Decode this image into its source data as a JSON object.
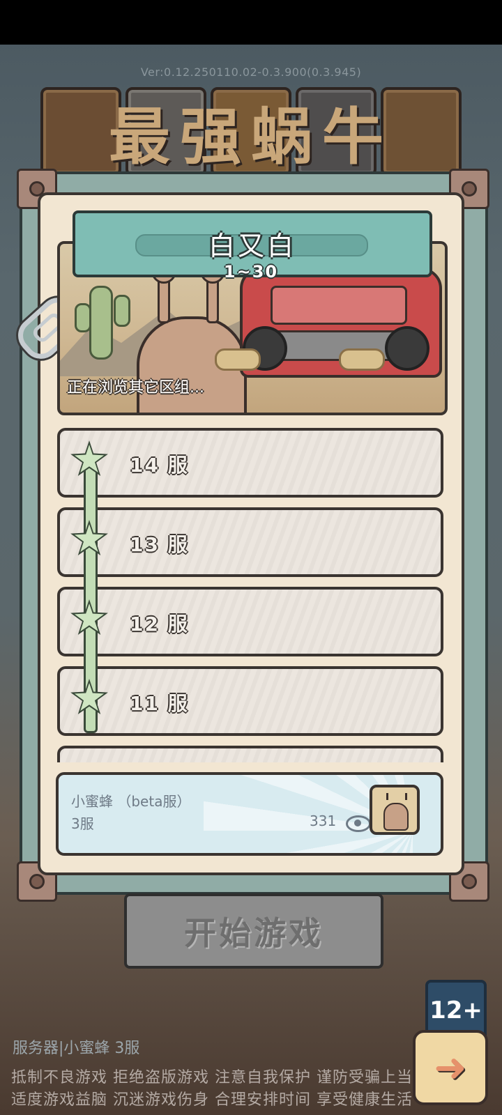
{
  "version": "Ver:0.12.250110.02-0.3.900(0.3.945)",
  "game_title": "最强蜗牛",
  "region": {
    "title": "白又白",
    "range": "1~30",
    "browsing_text": "正在浏览其它区组..."
  },
  "servers": [
    {
      "label": "14 服"
    },
    {
      "label": "13 服"
    },
    {
      "label": "12 服"
    },
    {
      "label": "11 服"
    }
  ],
  "current_server": {
    "name": "小蜜蜂 （beta服）",
    "number": "3服",
    "count": "331"
  },
  "start_button": "开始游戏",
  "age_rating": "12+",
  "server_status": "服务器|小蜜蜂 3服",
  "notice_line1": "抵制不良游戏 拒绝盗版游戏 注意自我保护 谨防受骗上当",
  "notice_line2": "适度游戏益脑 沉迷游戏伤身 合理安排时间 享受健康生活",
  "colors": {
    "panel": "#f2e6d2",
    "region_banner": "#7fbdb4",
    "frame": "#90aca6",
    "current_card": "#d8ebf0",
    "start_button": "#8d8d8d"
  },
  "icons": [
    "eye-icon",
    "avatar-snail-icon",
    "arrow-right-icon",
    "paperclip-icon",
    "star-icon"
  ]
}
